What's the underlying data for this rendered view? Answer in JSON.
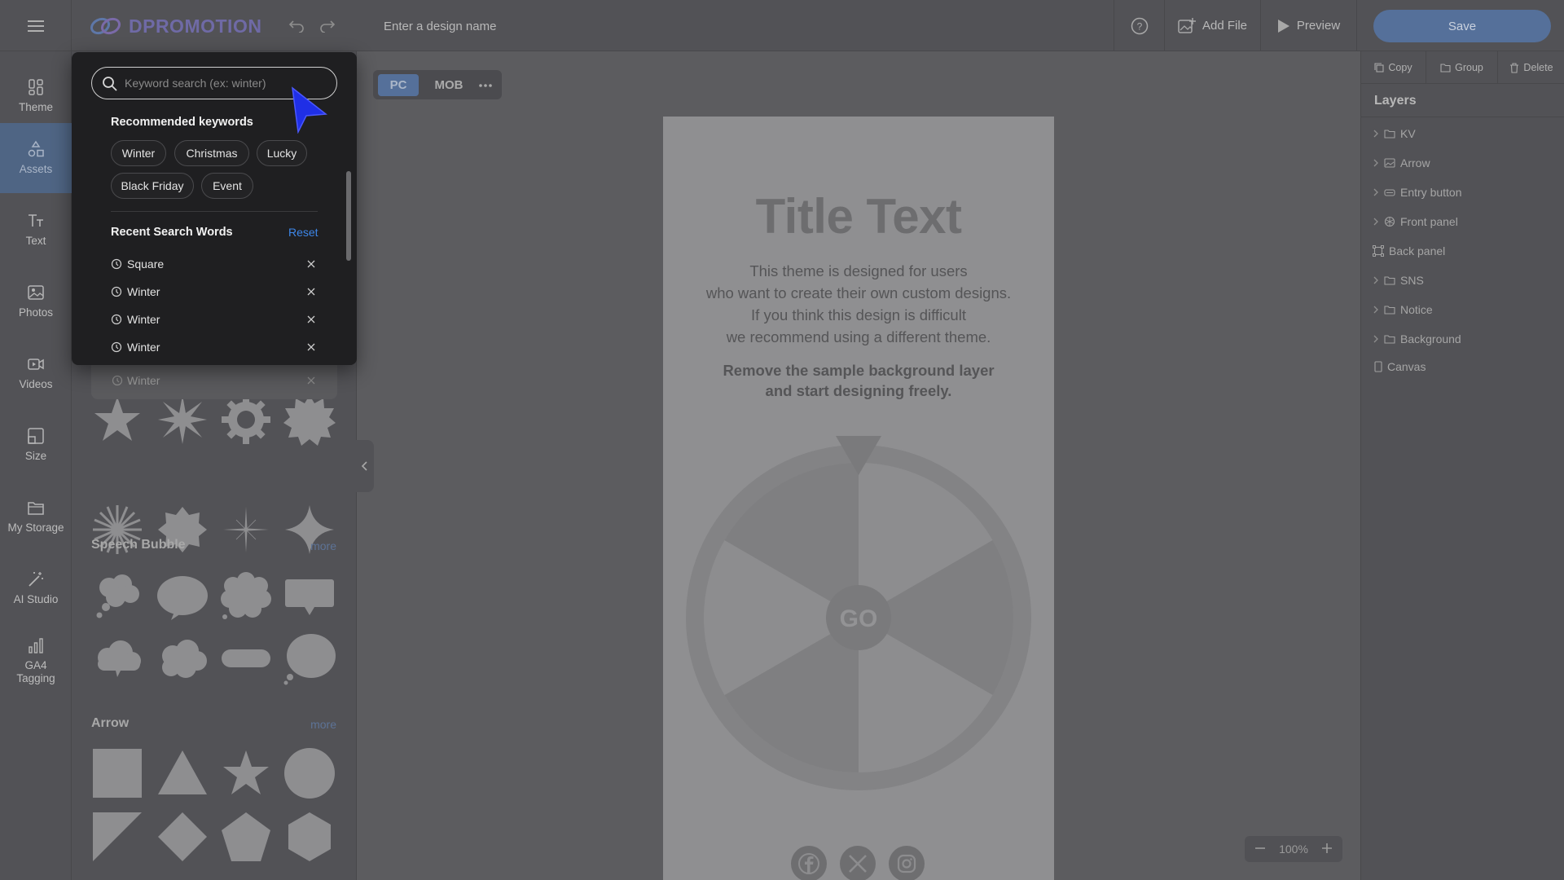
{
  "header": {
    "logo_text": "DPROMOTION",
    "design_name_placeholder": "Enter a design name",
    "add_file_label": "Add File",
    "preview_label": "Preview",
    "save_label": "Save"
  },
  "nav": {
    "items": [
      {
        "label": "Theme",
        "icon": "theme-icon"
      },
      {
        "label": "Assets",
        "icon": "assets-icon",
        "active": true
      },
      {
        "label": "Text",
        "icon": "text-icon"
      },
      {
        "label": "Photos",
        "icon": "photos-icon"
      },
      {
        "label": "Videos",
        "icon": "videos-icon"
      },
      {
        "label": "Size",
        "icon": "size-icon"
      },
      {
        "label": "My Storage",
        "icon": "folder-icon"
      },
      {
        "label": "AI Studio",
        "icon": "magic-wand-icon"
      },
      {
        "label": "GA4 Tagging",
        "icon": "bar-chart-icon"
      }
    ]
  },
  "search": {
    "placeholder": "Keyword search (ex: winter)",
    "recommended_title": "Recommended keywords",
    "keywords": [
      "Winter",
      "Christmas",
      "Lucky",
      "Black Friday",
      "Event"
    ],
    "recent_title": "Recent Search Words",
    "reset_label": "Reset",
    "recent": [
      "Square",
      "Winter",
      "Winter",
      "Winter",
      "Winter"
    ]
  },
  "assets": {
    "sections": [
      {
        "title": "Speech Bubble",
        "more": "more"
      },
      {
        "title": "Arrow",
        "more": "more"
      }
    ]
  },
  "canvas": {
    "device_pc": "PC",
    "device_mob": "MOB",
    "title": "Title Text",
    "body_lines": [
      "This theme is designed for users",
      "who want to create their own custom designs.",
      "If you think this design is difficult",
      "we recommend using a different theme."
    ],
    "strong_lines": [
      "Remove the sample background layer",
      "and start designing freely."
    ],
    "go_label": "GO",
    "zoom": "100%"
  },
  "right": {
    "tools": [
      "Copy",
      "Group",
      "Delete"
    ],
    "layers_title": "Layers",
    "layers": [
      {
        "label": "KV",
        "icon": "folder-icon",
        "expandable": true
      },
      {
        "label": "Arrow",
        "icon": "image-icon",
        "expandable": true
      },
      {
        "label": "Entry button",
        "icon": "button-icon",
        "expandable": true
      },
      {
        "label": "Front panel",
        "icon": "wheel-icon",
        "expandable": true
      },
      {
        "label": "Back panel",
        "icon": "frame-icon",
        "expandable": false
      },
      {
        "label": "SNS",
        "icon": "folder-icon",
        "expandable": true
      },
      {
        "label": "Notice",
        "icon": "folder-icon",
        "expandable": true
      },
      {
        "label": "Background",
        "icon": "folder-icon",
        "expandable": true
      },
      {
        "label": "Canvas",
        "icon": "page-icon",
        "expandable": false
      }
    ]
  },
  "colors": {
    "accent": "#3d86e8",
    "save_bg": "#55709a",
    "cursor": "#1f2fe6"
  }
}
